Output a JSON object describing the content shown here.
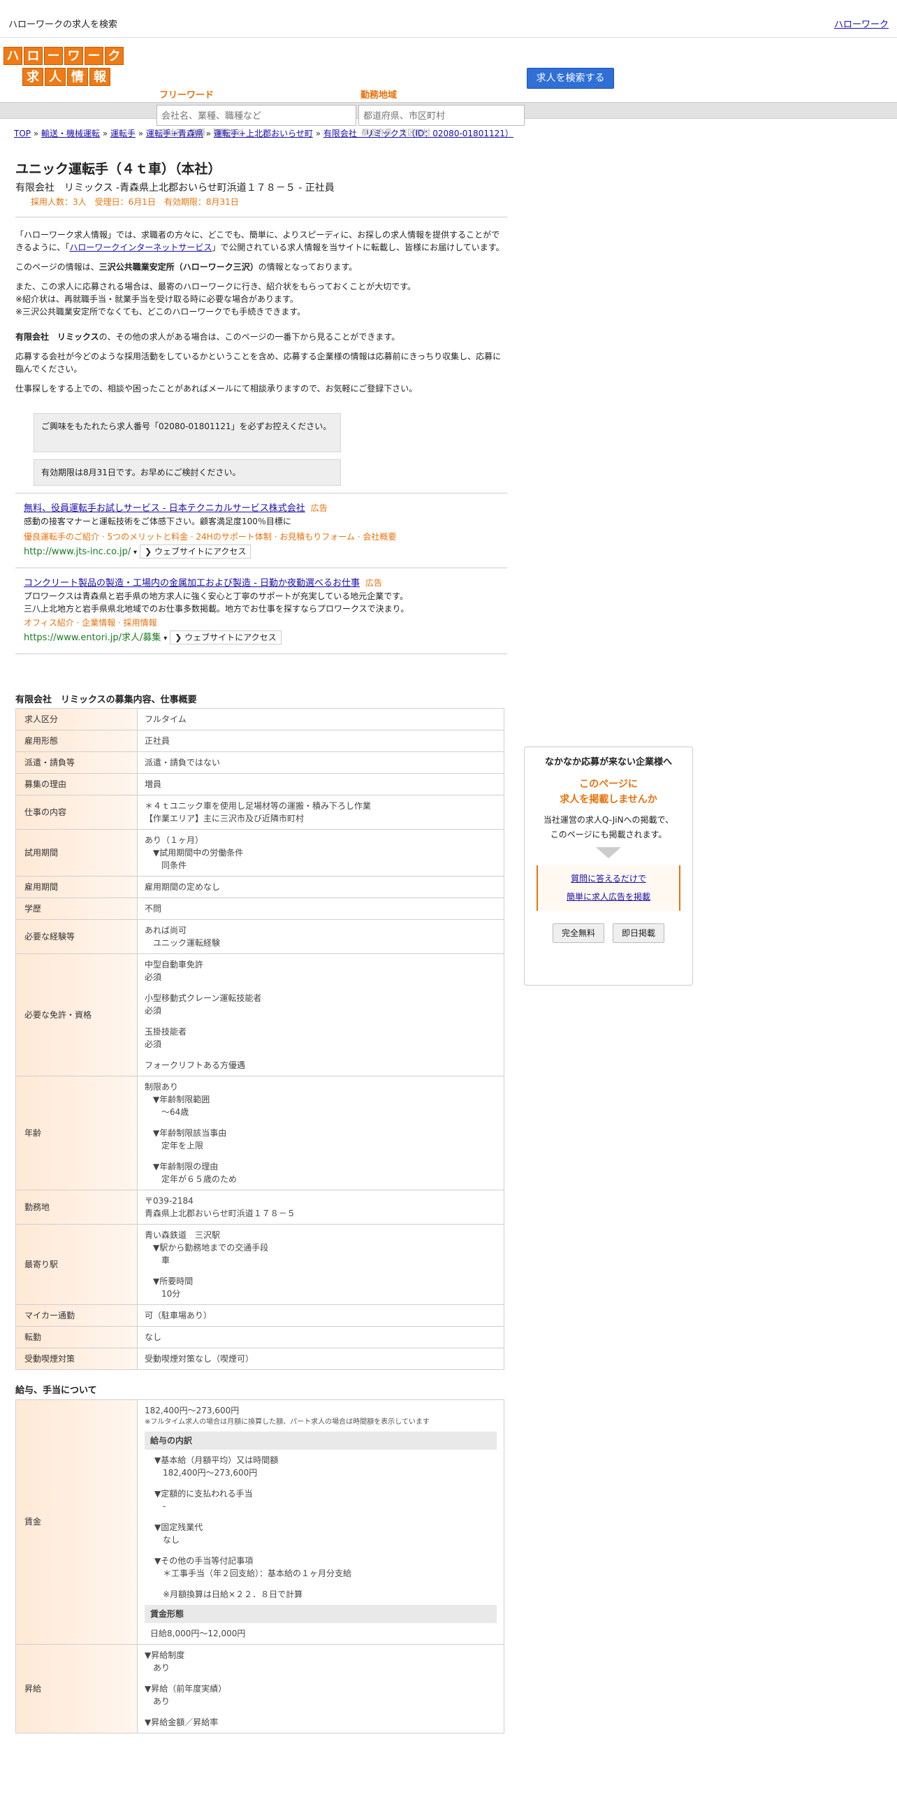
{
  "topbar": {
    "site_title": "ハローワークの求人を検索",
    "home_link": "ハローワーク"
  },
  "logo": {
    "row1": [
      "ハ",
      "ロ",
      "ー",
      "ワ",
      "ー",
      "ク"
    ],
    "row2": [
      "求",
      "人",
      "情",
      "報"
    ]
  },
  "search": {
    "free_label": "フリーワード",
    "free_placeholder": "会社名、業種、職種など",
    "area_label": "勤務地域",
    "area_placeholder": "都道府県、市区町村",
    "button": "求人を検索する"
  },
  "breadcrumb": [
    "TOP",
    "輸送・機械運転",
    "運転手",
    "運転手+青森県",
    "運転手+上北郡おいらせ町",
    "有限会社　リミックス（ID：02080-01801121）"
  ],
  "job": {
    "title": "ユニック運転手（４ｔ車）（本社）",
    "company_line": "有限会社　リミックス -青森県上北郡おいらせ町浜道１７８－５ - 正社員",
    "meta": "採用人数：3人　受理日：6月1日　有効期限：8月31日"
  },
  "intro": {
    "p1_a": "「ハローワーク求人情報」では、求職者の方々に、どこでも、簡単に、よりスピーディに、お探しの求人情報を提供することができるように、「",
    "p1_link": "ハローワークインターネットサービス",
    "p1_b": "」で公開されている求人情報を当サイトに転載し、皆様にお届けしています。",
    "p2_a": "このページの情報は、",
    "p2_bold": "三沢公共職業安定所（ハローワーク三沢）",
    "p2_b": "の情報となっております。",
    "p3_l1": "また、この求人に応募される場合は、最寄のハローワークに行き、紹介状をもらっておくことが大切です。",
    "p3_l2": "※紹介状は、再就職手当・就業手当を受け取る時に必要な場合があります。",
    "p3_l3": "※三沢公共職業安定所でなくても、どこのハローワークでも手続きできます。",
    "p4_bold": "有限会社　リミックス",
    "p4_rest": "の、その他の求人がある場合は、このページの一番下から見ることができます。",
    "p5": "応募する会社が今どのような採用活動をしているかということを含め、応募する企業様の情報は応募前にきっちり収集し、応募に臨んでください。",
    "p6": "仕事探しをする上での、相談や困ったことがあればメールにて相談承りますので、お気軽にご登録下さい。"
  },
  "notices": [
    "ご興味をもたれたら求人番号「02080-01801121」を必ずお控えください。",
    "有効期限は8月31日です。お早めにご検討ください。"
  ],
  "ads": [
    {
      "title": "無料、役員運転手お試しサービス - 日本テクニカルサービス株式会社",
      "tag": "広告",
      "desc": "感動の接客マナーと運転技術をご体感下さい。顧客満足度100％目標に",
      "links": "優良運転手のご紹介 · 5つのメリットと料金 · 24Hのサポート体制 · お見積もりフォーム · 会社概要",
      "url": "http://www.jts-inc.co.jp/",
      "visit": "ウェブサイトにアクセス"
    },
    {
      "title": "コンクリート製品の製造・工場内の金属加工および製造 - 日勤か夜勤選べるお仕事",
      "tag": "広告",
      "desc1": "プロワークスは青森県と岩手県の地方求人に強く安心と丁寧のサポートが充実している地元企業です。",
      "desc2": "三八上北地方と岩手県県北地域でのお仕事多数掲載。地方でお仕事を探すならプロワークスで決まり。",
      "links": "オフィス紹介 · 企業情報 · 採用情報",
      "url": "https://www.entori.jp/求人/募集",
      "visit": "ウェブサイトにアクセス"
    }
  ],
  "overview": {
    "heading": "有限会社　リミックスの募集内容、仕事概要",
    "rows": [
      {
        "label": "求人区分",
        "lines": [
          "フルタイム"
        ]
      },
      {
        "label": "雇用形態",
        "lines": [
          "正社員"
        ]
      },
      {
        "label": "派遣・請負等",
        "lines": [
          "派遣・請負ではない"
        ]
      },
      {
        "label": "募集の理由",
        "lines": [
          "増員"
        ]
      },
      {
        "label": "仕事の内容",
        "lines": [
          "＊４ｔユニック車を使用し足場材等の運搬・積み下ろし作業",
          "【作業エリア】主に三沢市及び近隣市町村"
        ]
      },
      {
        "label": "試用期間",
        "lines": [
          "あり（１ヶ月）",
          "　▼試用期間中の労働条件",
          "　　同条件"
        ]
      },
      {
        "label": "雇用期間",
        "lines": [
          "雇用期間の定めなし"
        ]
      },
      {
        "label": "学歴",
        "lines": [
          "不問"
        ]
      },
      {
        "label": "必要な経験等",
        "lines": [
          "あれば尚可",
          "　ユニック運転経験"
        ]
      },
      {
        "label": "必要な免許・資格",
        "lines": [
          "中型自動車免許",
          "必須",
          "",
          "小型移動式クレーン運転技能者",
          "必須",
          "",
          "玉掛技能者",
          "必須",
          "",
          "フォークリフトある方優遇"
        ]
      },
      {
        "label": "年齢",
        "lines": [
          "制限あり",
          "　▼年齢制限範囲",
          "　　〜64歳",
          "",
          "　▼年齢制限該当事由",
          "　　定年を上限",
          "",
          "　▼年齢制限の理由",
          "　　定年が６５歳のため"
        ]
      },
      {
        "label": "勤務地",
        "lines": [
          "〒039-2184",
          "青森県上北郡おいらせ町浜道１７８－５"
        ]
      },
      {
        "label": "最寄り駅",
        "lines": [
          "青い森鉄道　三沢駅",
          "　▼駅から勤務地までの交通手段",
          "　　車",
          "",
          "　▼所要時間",
          "　　10分"
        ]
      },
      {
        "label": "マイカー通勤",
        "lines": [
          "可（駐車場あり）"
        ]
      },
      {
        "label": "転勤",
        "lines": [
          "なし"
        ]
      },
      {
        "label": "受動喫煙対策",
        "lines": [
          "受動喫煙対策なし（喫煙可）"
        ]
      }
    ]
  },
  "salary": {
    "heading": "給与、手当について",
    "wage_label": "賃金",
    "wage_range": "182,400円〜273,600円",
    "wage_note": "※フルタイム求人の場合は月額に換算した額、パート求人の場合は時間額を表示しています",
    "breakdown_head": "給与の内訳",
    "breakdown_lines": [
      "▼基本給（月額平均）又は時間額",
      "　182,400円〜273,600円",
      "",
      "▼定額的に支払われる手当",
      "　-",
      "",
      "▼固定残業代",
      "　なし",
      "",
      "▼その他の手当等付記事項",
      "　＊工事手当（年２回支給）：基本給の１ヶ月分支給",
      "",
      "　※月額換算は日給×２２．８日で計算"
    ],
    "form_head": "賃金形態",
    "form_value": "日給8,000円〜12,000円",
    "raise_label": "昇給",
    "raise_lines": [
      "▼昇給制度",
      "　あり",
      "",
      "▼昇給（前年度実績）",
      "　あり",
      "",
      "▼昇給金額／昇給率"
    ]
  },
  "side": {
    "title": "なかなか応募が来ない企業様へ",
    "catch1": "このページに",
    "catch2": "求人を掲載しませんか",
    "text1": "当社運営の求人Q-JiNへの掲載で、",
    "text2": "このページにも掲載されます。",
    "link1": "質問に答えるだけで",
    "link2": "簡単に求人広告を掲載",
    "btn1": "完全無料",
    "btn2": "即日掲載"
  }
}
